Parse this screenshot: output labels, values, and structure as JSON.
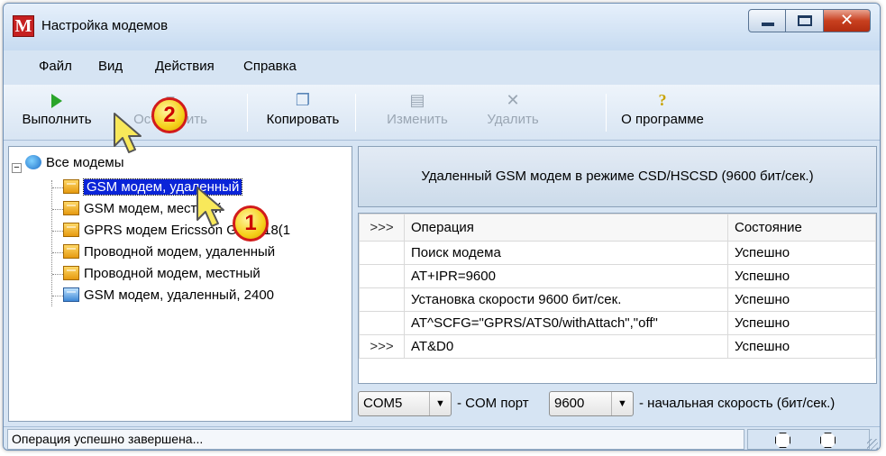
{
  "window": {
    "title": "Настройка модемов",
    "app_icon_letter": "M",
    "close_glyph": "✕"
  },
  "menu": [
    "Файл",
    "Вид",
    "Действия",
    "Справка"
  ],
  "toolbar": {
    "run": "Выполнить",
    "stop": "Остановить",
    "copy": "Копировать",
    "edit": "Изменить",
    "delete": "Удалить",
    "about": "О программе",
    "about_glyph": "?",
    "delete_glyph": "✕"
  },
  "tree": {
    "root": "Все модемы",
    "items": [
      {
        "label": "GSM модем, удаленный",
        "icon": "server-icon",
        "selected": true
      },
      {
        "label": "GSM модем, местный",
        "icon": "server-icon"
      },
      {
        "label": "GPRS модем Ericsson GM1318(1",
        "icon": "server-icon"
      },
      {
        "label": "Проводной модем, удаленный",
        "icon": "server-icon"
      },
      {
        "label": "Проводной модем, местный",
        "icon": "server-icon"
      },
      {
        "label": "GSM модем, удаленный, 2400",
        "icon": "network-server-icon"
      }
    ]
  },
  "details": {
    "header": "Удаленный GSM модем в режиме CSD/HSCSD (9600 бит/сек.)",
    "columns": [
      ">>>",
      "Операция",
      "Состояние"
    ],
    "rows": [
      {
        "marker": "",
        "op": "Поиск модема",
        "status": "Успешно"
      },
      {
        "marker": "",
        "op": "AT+IPR=9600",
        "status": "Успешно"
      },
      {
        "marker": "",
        "op": "Установка скорости 9600 бит/сек.",
        "status": "Успешно"
      },
      {
        "marker": "",
        "op": "AT^SCFG=\"GPRS/ATS0/withAttach\",\"off\"",
        "status": "Успешно"
      },
      {
        "marker": ">>>",
        "op": "AT&D0",
        "status": "Успешно"
      }
    ]
  },
  "bottom": {
    "port_value": "COM5",
    "port_label": "- COM порт",
    "speed_value": "9600",
    "speed_label": "- начальная скорость (бит/сек.)",
    "combo_arrow": "▼"
  },
  "status": {
    "text": "Операция успешно завершена..."
  },
  "annotations": {
    "callout1": "1",
    "callout2": "2"
  }
}
